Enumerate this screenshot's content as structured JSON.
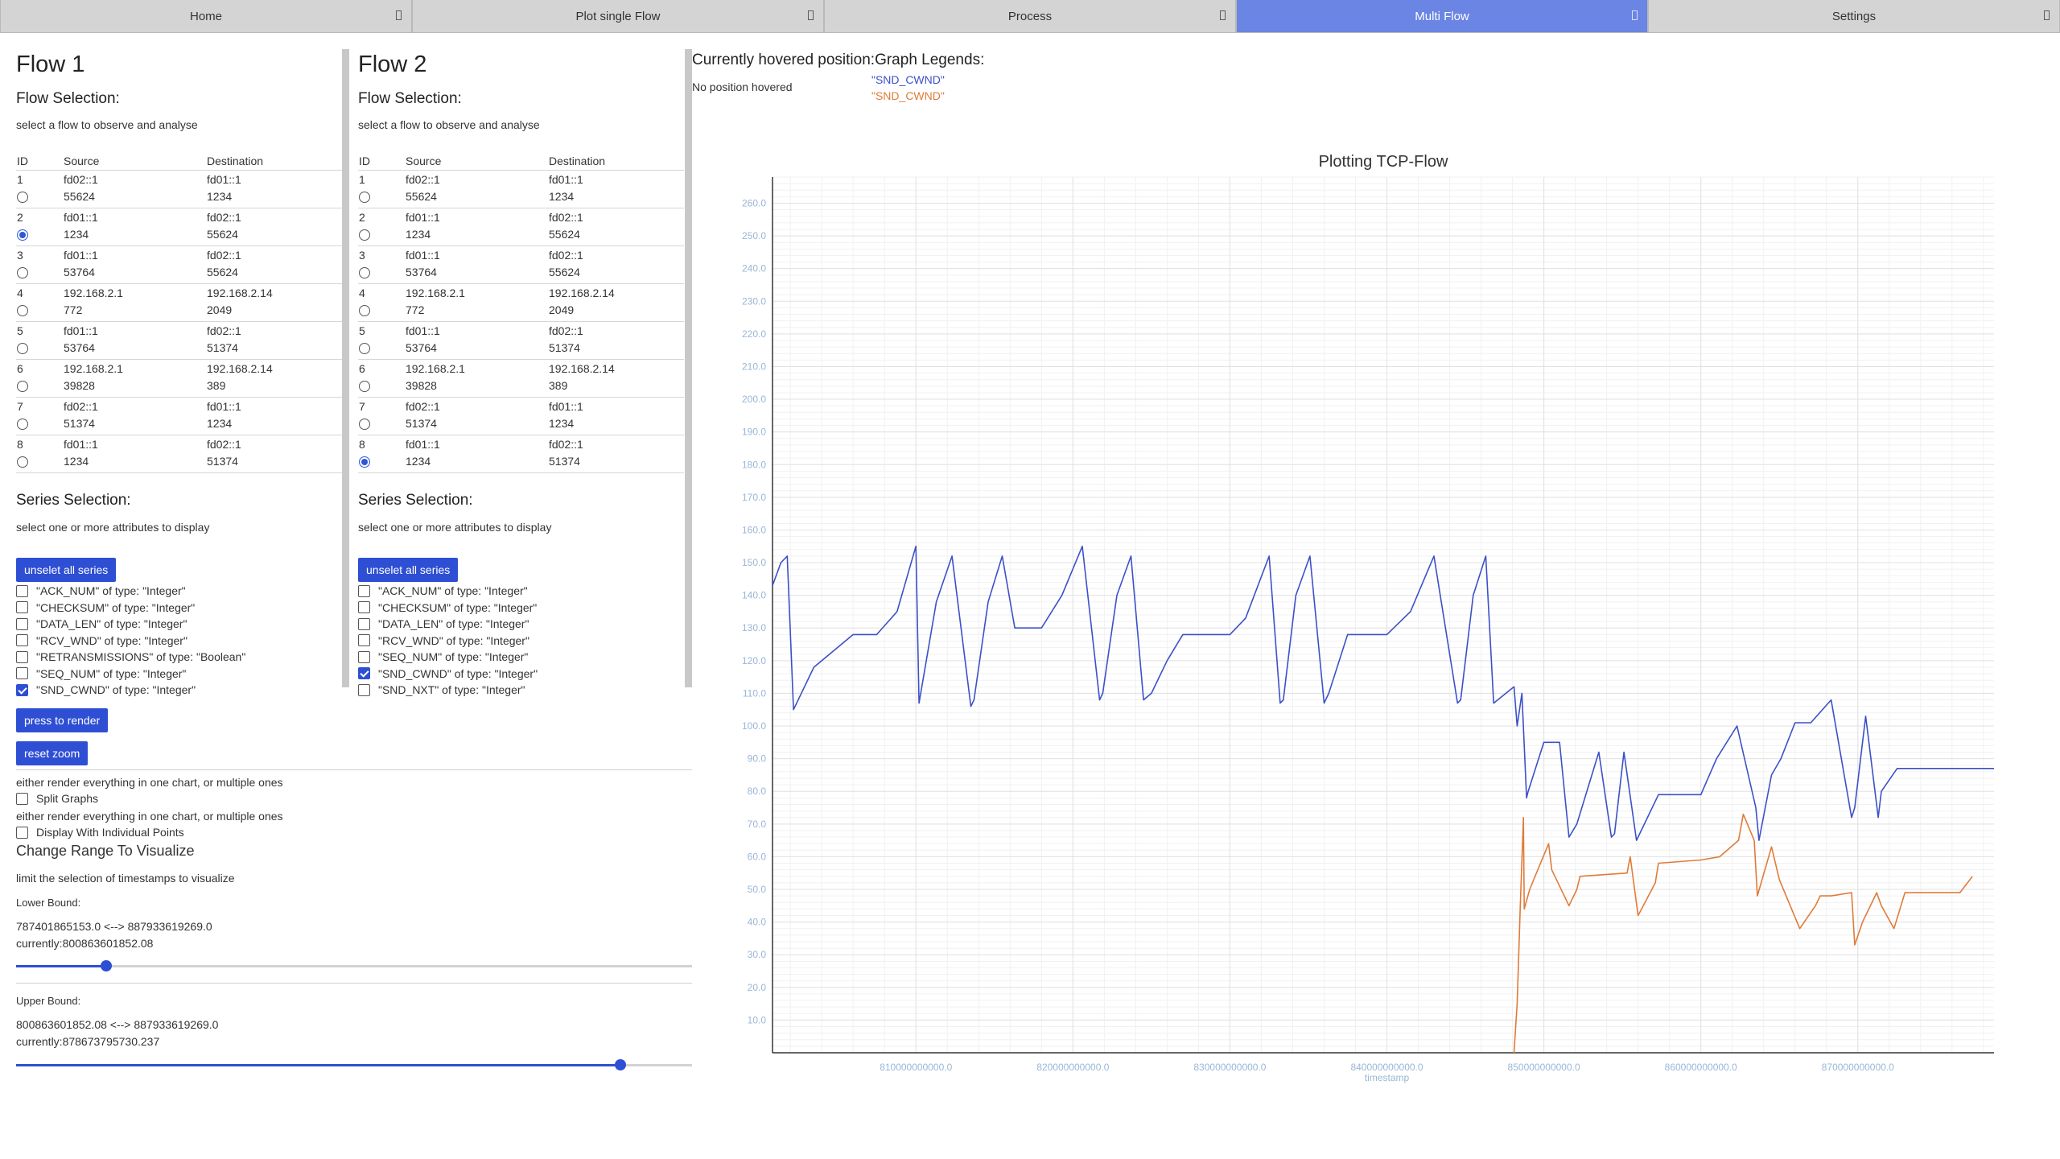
{
  "tabs": [
    {
      "label": "Home",
      "active": false
    },
    {
      "label": "Plot single Flow",
      "active": false
    },
    {
      "label": "Process",
      "active": false
    },
    {
      "label": "Multi Flow",
      "active": true
    },
    {
      "label": "Settings",
      "active": false
    }
  ],
  "flows": [
    {
      "title": "Flow 1",
      "flow_selection_title": "Flow Selection:",
      "flow_selection_desc": "select a flow to observe and analyse",
      "columns": [
        "ID",
        "Source",
        "Destination"
      ],
      "rows": [
        {
          "id": "1",
          "src": "fd02::1",
          "src_port": "55624",
          "dst": "fd01::1",
          "dst_port": "1234",
          "selected": false
        },
        {
          "id": "2",
          "src": "fd01::1",
          "src_port": "1234",
          "dst": "fd02::1",
          "dst_port": "55624",
          "selected": true
        },
        {
          "id": "3",
          "src": "fd01::1",
          "src_port": "53764",
          "dst": "fd02::1",
          "dst_port": "55624",
          "selected": false
        },
        {
          "id": "4",
          "src": "192.168.2.1",
          "src_port": "772",
          "dst": "192.168.2.14",
          "dst_port": "2049",
          "selected": false
        },
        {
          "id": "5",
          "src": "fd01::1",
          "src_port": "53764",
          "dst": "fd02::1",
          "dst_port": "51374",
          "selected": false
        },
        {
          "id": "6",
          "src": "192.168.2.1",
          "src_port": "39828",
          "dst": "192.168.2.14",
          "dst_port": "389",
          "selected": false
        },
        {
          "id": "7",
          "src": "fd02::1",
          "src_port": "51374",
          "dst": "fd01::1",
          "dst_port": "1234",
          "selected": false
        },
        {
          "id": "8",
          "src": "fd01::1",
          "src_port": "1234",
          "dst": "fd02::1",
          "dst_port": "51374",
          "selected": false
        }
      ],
      "series_title": "Series Selection:",
      "series_desc": "select one or more attributes to display",
      "unselect_label": "unselet all series",
      "series": [
        {
          "label": "\"ACK_NUM\" of type: \"Integer\"",
          "checked": false
        },
        {
          "label": "\"CHECKSUM\" of type: \"Integer\"",
          "checked": false
        },
        {
          "label": "\"DATA_LEN\" of type: \"Integer\"",
          "checked": false
        },
        {
          "label": "\"RCV_WND\" of type: \"Integer\"",
          "checked": false
        },
        {
          "label": "\"RETRANSMISSIONS\" of type: \"Boolean\"",
          "checked": false
        },
        {
          "label": "\"SEQ_NUM\" of type: \"Integer\"",
          "checked": false
        },
        {
          "label": "\"SND_CWND\" of type: \"Integer\"",
          "checked": true
        }
      ]
    },
    {
      "title": "Flow 2",
      "flow_selection_title": "Flow Selection:",
      "flow_selection_desc": "select a flow to observe and analyse",
      "columns": [
        "ID",
        "Source",
        "Destination"
      ],
      "rows": [
        {
          "id": "1",
          "src": "fd02::1",
          "src_port": "55624",
          "dst": "fd01::1",
          "dst_port": "1234",
          "selected": false
        },
        {
          "id": "2",
          "src": "fd01::1",
          "src_port": "1234",
          "dst": "fd02::1",
          "dst_port": "55624",
          "selected": false
        },
        {
          "id": "3",
          "src": "fd01::1",
          "src_port": "53764",
          "dst": "fd02::1",
          "dst_port": "55624",
          "selected": false
        },
        {
          "id": "4",
          "src": "192.168.2.1",
          "src_port": "772",
          "dst": "192.168.2.14",
          "dst_port": "2049",
          "selected": false
        },
        {
          "id": "5",
          "src": "fd01::1",
          "src_port": "53764",
          "dst": "fd02::1",
          "dst_port": "51374",
          "selected": false
        },
        {
          "id": "6",
          "src": "192.168.2.1",
          "src_port": "39828",
          "dst": "192.168.2.14",
          "dst_port": "389",
          "selected": false
        },
        {
          "id": "7",
          "src": "fd02::1",
          "src_port": "51374",
          "dst": "fd01::1",
          "dst_port": "1234",
          "selected": false
        },
        {
          "id": "8",
          "src": "fd01::1",
          "src_port": "1234",
          "dst": "fd02::1",
          "dst_port": "51374",
          "selected": true
        }
      ],
      "series_title": "Series Selection:",
      "series_desc": "select one or more attributes to display",
      "unselect_label": "unselet all series",
      "series": [
        {
          "label": "\"ACK_NUM\" of type: \"Integer\"",
          "checked": false
        },
        {
          "label": "\"CHECKSUM\" of type: \"Integer\"",
          "checked": false
        },
        {
          "label": "\"DATA_LEN\" of type: \"Integer\"",
          "checked": false
        },
        {
          "label": "\"RCV_WND\" of type: \"Integer\"",
          "checked": false
        },
        {
          "label": "\"SEQ_NUM\" of type: \"Integer\"",
          "checked": false
        },
        {
          "label": "\"SND_CWND\" of type: \"Integer\"",
          "checked": true
        },
        {
          "label": "\"SND_NXT\" of type: \"Integer\"",
          "checked": false
        }
      ]
    }
  ],
  "controls": {
    "render_label": "press to render",
    "reset_zoom_label": "reset zoom",
    "split_desc": "either render everything in one chart, or multiple ones",
    "split_label": "Split Graphs",
    "split_checked": false,
    "points_desc": "either render everything in one chart, or multiple ones",
    "points_label": "Display With Individual Points",
    "points_checked": false,
    "range_title": "Change Range To Visualize",
    "range_desc": "limit the selection of timestamps to visualize",
    "lower": {
      "label": "Lower Bound:",
      "range_text": "787401865153.0 <--> 887933619269.0",
      "current_text": "currently:800863601852.08",
      "min": 787401865153.0,
      "max": 887933619269.0,
      "value": 800863601852.08
    },
    "upper": {
      "label": "Upper Bound:",
      "range_text": "800863601852.08 <--> 887933619269.0",
      "current_text": "currently:878673795730.237",
      "min": 800863601852.08,
      "max": 887933619269.0,
      "value": 878673795730.237
    }
  },
  "hover": {
    "title": "Currently hovered position:",
    "value": "No position hovered"
  },
  "legend": {
    "title": "Graph Legends:",
    "items": [
      {
        "label": "\"SND_CWND\"",
        "color": "#3c50c8"
      },
      {
        "label": "\"SND_CWND\"",
        "color": "#e07b39"
      }
    ]
  },
  "colors": {
    "accent": "#2e4fd4",
    "tab_active": "#6a85e3",
    "series_blue": "#3c50c8",
    "series_orange": "#e07b39",
    "tick": "#9ab6d6"
  },
  "chart_data": {
    "type": "line",
    "title": "Plotting TCP-Flow",
    "xlabel": "timestamp",
    "ylabel": "",
    "xlim": [
      800863601852.08,
      878673795730.237
    ],
    "ylim": [
      0,
      268
    ],
    "grid": true,
    "legend": "none",
    "x_ticks": [
      "810000000000.0",
      "820000000000.0",
      "830000000000.0",
      "840000000000.0",
      "850000000000.0",
      "860000000000.0",
      "870000000000.0"
    ],
    "x_tick_values": [
      810000000000,
      820000000000,
      830000000000,
      840000000000,
      850000000000,
      860000000000,
      870000000000
    ],
    "y_ticks": [
      "10.0",
      "20.0",
      "30.0",
      "40.0",
      "50.0",
      "60.0",
      "70.0",
      "80.0",
      "90.0",
      "100.0",
      "110.0",
      "120.0",
      "130.0",
      "140.0",
      "150.0",
      "160.0",
      "170.0",
      "180.0",
      "190.0",
      "200.0",
      "210.0",
      "220.0",
      "230.0",
      "240.0",
      "250.0",
      "260.0"
    ],
    "y_tick_values": [
      10,
      20,
      30,
      40,
      50,
      60,
      70,
      80,
      90,
      100,
      110,
      120,
      130,
      140,
      150,
      160,
      170,
      180,
      190,
      200,
      210,
      220,
      230,
      240,
      250,
      260
    ],
    "series": [
      {
        "color": "#3c50c8",
        "x": [
          800863601852,
          801400000000,
          801800000000,
          802200000000,
          803500000000,
          806000000000,
          807500000000,
          808800000000,
          810000000000,
          810200000000,
          811300000000,
          812300000000,
          813500000000,
          813700000000,
          814600000000,
          815500000000,
          816300000000,
          818000000000,
          819300000000,
          820600000000,
          821700000000,
          821900000000,
          822800000000,
          823700000000,
          824500000000,
          825000000000,
          826000000000,
          827000000000,
          828500000000,
          830000000000,
          831000000000,
          832500000000,
          833200000000,
          833400000000,
          834200000000,
          835100000000,
          836000000000,
          836300000000,
          837500000000,
          838500000000,
          840000000000,
          841500000000,
          843000000000,
          844500000000,
          844700000000,
          845500000000,
          846300000000,
          846800000000,
          848100000000,
          848300000000,
          848600000000,
          848900000000,
          849000000000,
          850000000000,
          851000000000,
          851600000000,
          852100000000,
          853500000000,
          854300000000,
          854500000000,
          855100000000,
          855900000000,
          856200000000,
          857300000000,
          860000000000,
          861000000000,
          862300000000,
          863500000000,
          863700000000,
          864500000000,
          865100000000,
          866000000000,
          867000000000,
          868300000000,
          869600000000,
          869800000000,
          870500000000,
          871300000000,
          871500000000,
          872500000000,
          873300000000,
          874500000000,
          876000000000,
          877400000000,
          878673795730
        ],
        "y": [
          143,
          150,
          152,
          105,
          118,
          128,
          128,
          135,
          155,
          107,
          138,
          152,
          106,
          108,
          138,
          152,
          130,
          130,
          140,
          155,
          108,
          110,
          140,
          152,
          108,
          110,
          120,
          128,
          128,
          128,
          133,
          152,
          107,
          108,
          140,
          152,
          107,
          110,
          128,
          128,
          128,
          135,
          152,
          107,
          108,
          140,
          152,
          107,
          112,
          100,
          110,
          78,
          80,
          95,
          95,
          66,
          70,
          92,
          66,
          67,
          92,
          65,
          68,
          79,
          79,
          90,
          100,
          75,
          65,
          85,
          90,
          101,
          101,
          108,
          72,
          75,
          103,
          72,
          80,
          87,
          87,
          87,
          87,
          87,
          87
        ]
      },
      {
        "color": "#e07b39",
        "x": [
          848100000000,
          848300000000,
          848500000000,
          848700000000,
          848750000000,
          849100000000,
          850300000000,
          850500000000,
          851600000000,
          852100000000,
          852300000000,
          855300000000,
          855500000000,
          856000000000,
          857100000000,
          857300000000,
          860000000000,
          861200000000,
          862400000000,
          862700000000,
          863400000000,
          863600000000,
          864500000000,
          865000000000,
          866300000000,
          867300000000,
          867600000000,
          868300000000,
          869600000000,
          869800000000,
          870300000000,
          871200000000,
          871500000000,
          872300000000,
          873000000000,
          876500000000,
          877300000000
        ],
        "y": [
          0,
          15,
          45,
          72,
          44,
          50,
          64,
          56,
          45,
          50,
          54,
          55,
          60,
          42,
          52,
          58,
          59,
          60,
          65,
          73,
          65,
          48,
          63,
          53,
          38,
          45,
          48,
          48,
          49,
          33,
          40,
          49,
          45,
          38,
          49,
          49,
          54
        ]
      }
    ]
  }
}
